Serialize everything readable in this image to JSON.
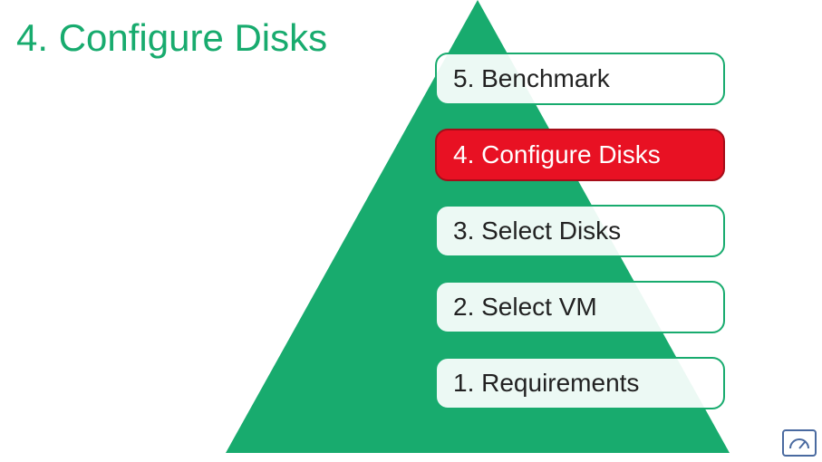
{
  "title": "4. Configure Disks",
  "colors": {
    "accent_green": "#18ab6e",
    "active_red": "#e81123",
    "border_green": "#18ab6e",
    "logo_blue": "#4a6aa0"
  },
  "steps": [
    {
      "label": "5. Benchmark",
      "active": false
    },
    {
      "label": "4. Configure Disks",
      "active": true
    },
    {
      "label": "3. Select Disks",
      "active": false
    },
    {
      "label": "2. Select VM",
      "active": false
    },
    {
      "label": "1. Requirements",
      "active": false
    }
  ]
}
